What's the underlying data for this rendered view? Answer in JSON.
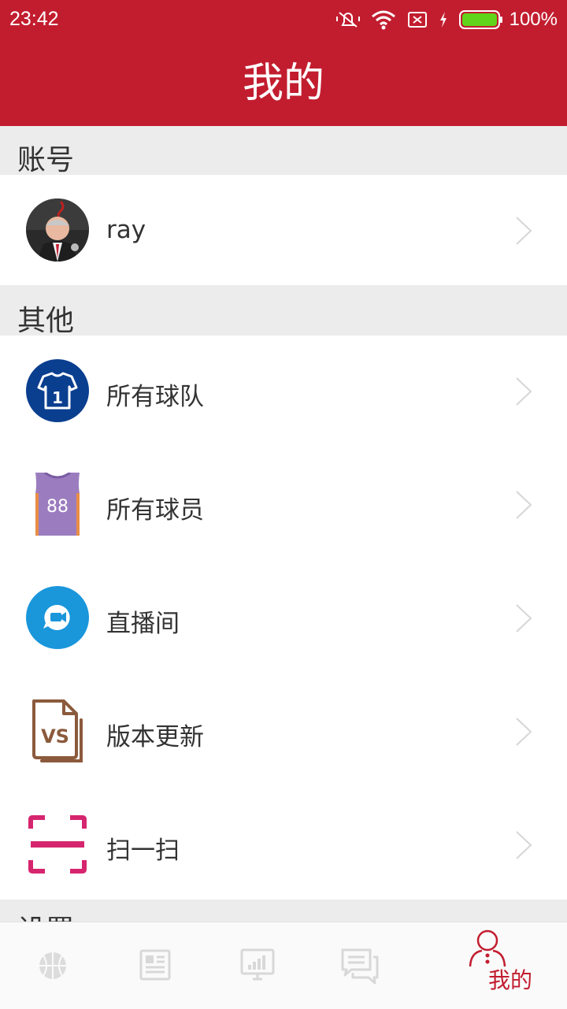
{
  "status": {
    "time": "23:42",
    "battery": "100%"
  },
  "header": {
    "title": "我的"
  },
  "sections": {
    "account": "账号",
    "other": "其他",
    "settings_peek": "设置"
  },
  "account": {
    "username": "ray"
  },
  "menu": {
    "teams": "所有球队",
    "players": "所有球员",
    "live": "直播间",
    "update": "版本更新",
    "scan": "扫一扫"
  },
  "icons": {
    "teams": "jersey-number-1-icon",
    "players": "jersey-88-icon",
    "live": "video-chat-icon",
    "update": "vs-file-icon",
    "scan": "scan-icon"
  },
  "tabs": [
    {
      "name": "basketball",
      "label": ""
    },
    {
      "name": "news",
      "label": ""
    },
    {
      "name": "stats",
      "label": ""
    },
    {
      "name": "chat",
      "label": ""
    },
    {
      "name": "mine",
      "label": "我的",
      "active": true
    }
  ],
  "colors": {
    "brand": "#c21d2f",
    "jersey_blue": "#0a3e8f",
    "live_blue": "#1a96db",
    "update_brown": "#8b5a3c",
    "scan_pink": "#d6256f"
  }
}
